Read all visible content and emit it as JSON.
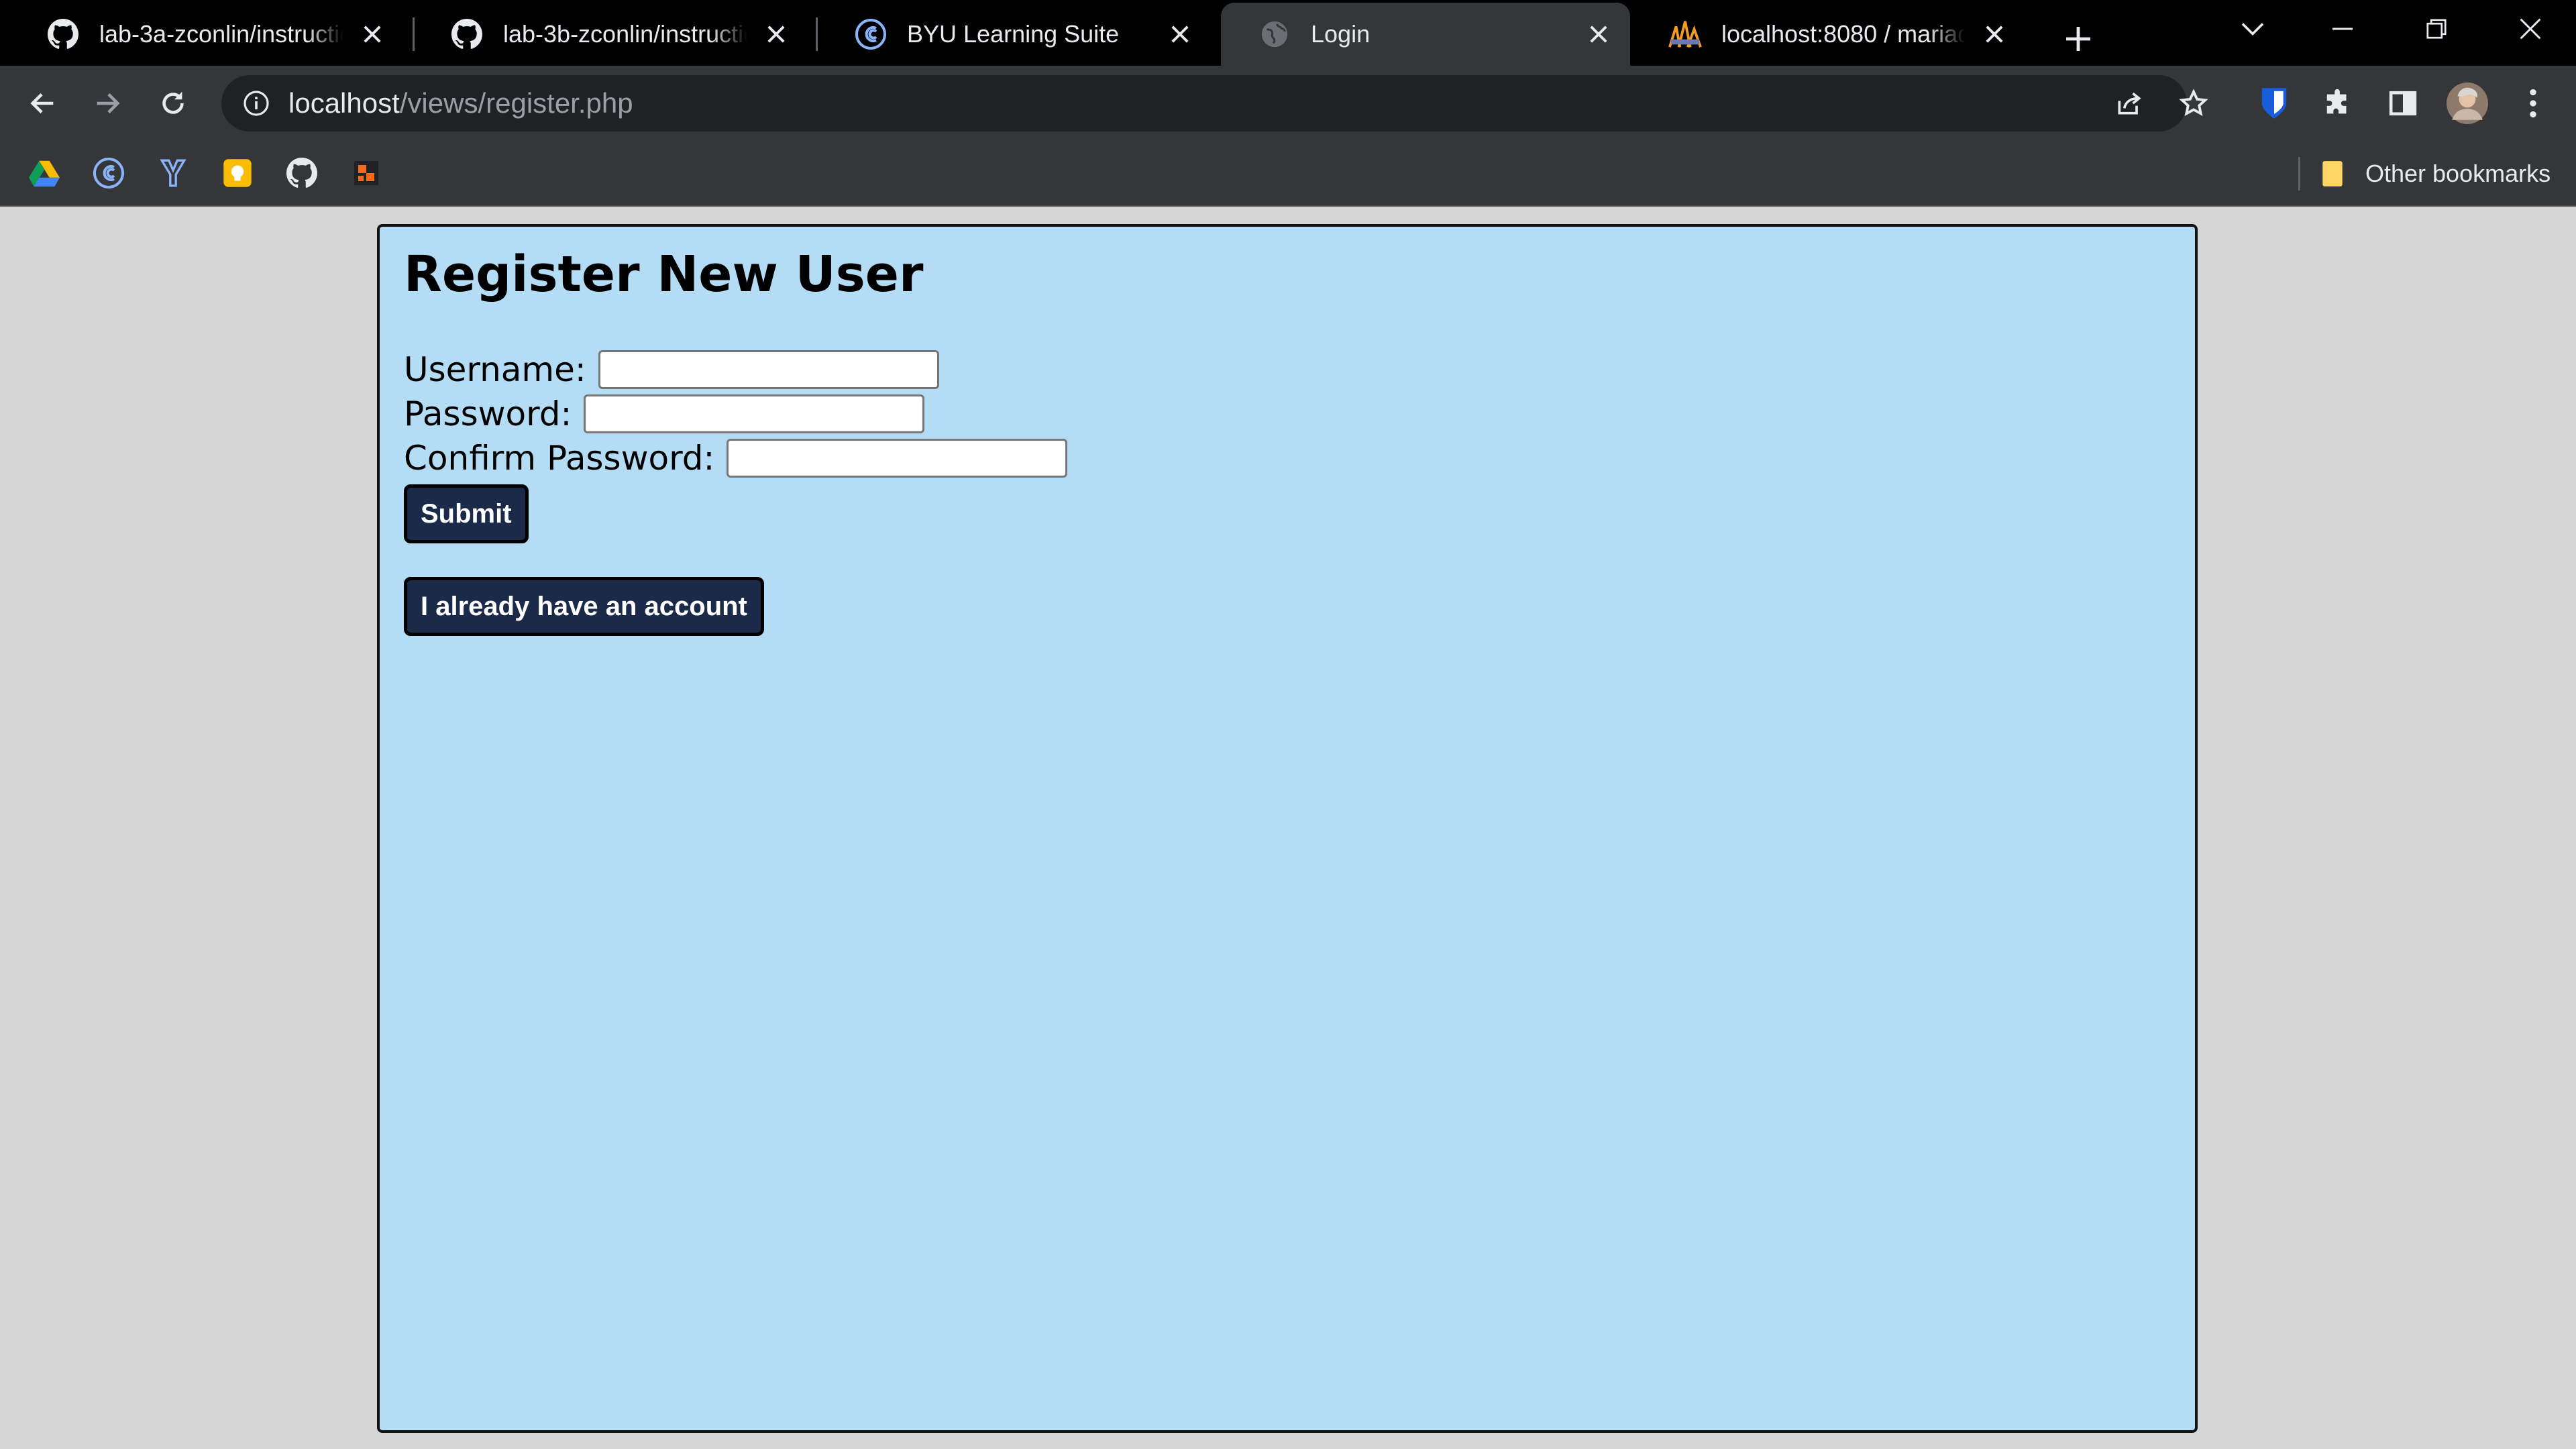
{
  "tabs": [
    {
      "title": "lab-3a-zconlin/instructions",
      "icon": "github-icon",
      "active": false
    },
    {
      "title": "lab-3b-zconlin/instructions",
      "icon": "github-icon",
      "active": false
    },
    {
      "title": "BYU Learning Suite",
      "icon": "learning-suite-icon",
      "active": false
    },
    {
      "title": "Login",
      "icon": "globe-icon",
      "active": true
    },
    {
      "title": "localhost:8080 / mariadb",
      "icon": "phpmyadmin-icon",
      "active": false
    }
  ],
  "address_bar": {
    "host": "localhost",
    "path": "/views/register.php"
  },
  "bookmarks": {
    "items": [
      "google-drive-icon",
      "learning-suite-icon",
      "y-icon",
      "keep-icon",
      "github-icon",
      "orange-blocks-icon"
    ],
    "other_label": "Other bookmarks"
  },
  "form": {
    "heading": "Register New User",
    "username_label": "Username:",
    "username_value": "",
    "password_label": "Password:",
    "password_value": "",
    "confirm_label": "Confirm Password:",
    "confirm_value": "",
    "submit_label": "Submit",
    "login_link_label": "I already have an account"
  },
  "colors": {
    "card_bg": "#b4dcf4",
    "button_bg": "#1a2a48",
    "page_bg": "#d6d6d6"
  }
}
